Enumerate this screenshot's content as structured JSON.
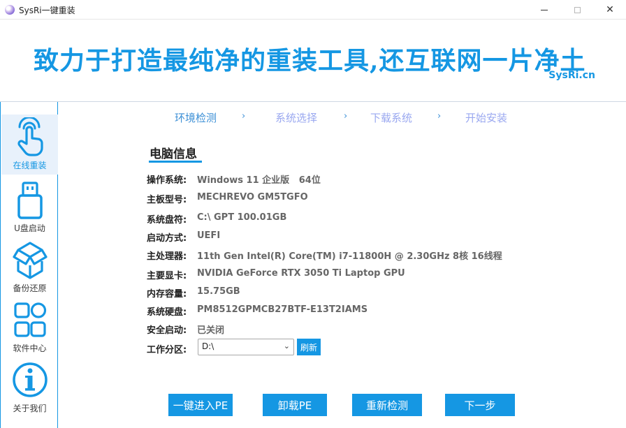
{
  "window": {
    "title": "SysRi一键重装",
    "minimize_icon": "minimize-icon",
    "maximize_icon": "maximize-icon",
    "close_icon": "close-icon",
    "close_glyph": "✕"
  },
  "banner": {
    "slogan": "致力于打造最纯净的重装工具,还互联网一片净土",
    "brand": "SysRi.cn",
    "accent_color": "#1597e3"
  },
  "sidebar": {
    "items": [
      {
        "label": "在线重装",
        "icon": "hand-pointer-icon",
        "active": true
      },
      {
        "label": "U盘启动",
        "icon": "usb-drive-icon",
        "active": false
      },
      {
        "label": "备份还原",
        "icon": "box-backup-icon",
        "active": false
      },
      {
        "label": "软件中心",
        "icon": "apps-grid-icon",
        "active": false
      },
      {
        "label": "关于我们",
        "icon": "info-icon",
        "active": false
      }
    ]
  },
  "steps": {
    "items": [
      "环境检测",
      "系统选择",
      "下载系统",
      "开始安装"
    ],
    "arrow": "›",
    "active_index": 0
  },
  "info": {
    "title": "电脑信息",
    "rows": [
      {
        "label": "操作系统:",
        "value": "Windows 11 企业版   64位"
      },
      {
        "label": "主板型号:",
        "value": "MECHREVO GM5TGFO"
      },
      {
        "label": "系统盘符:",
        "value": "C:\\ GPT 100.01GB"
      },
      {
        "label": "启动方式:",
        "value": "UEFI"
      },
      {
        "label": "主处理器:",
        "value": "11th Gen Intel(R) Core(TM) i7-11800H @ 2.30GHz 8核 16线程"
      },
      {
        "label": "主要显卡:",
        "value": "NVIDIA GeForce RTX 3050 Ti Laptop GPU"
      },
      {
        "label": "内存容量:",
        "value": "15.75GB"
      },
      {
        "label": "系统硬盘:",
        "value": "PM8512GPMCB27BTF-E13T2IAMS"
      },
      {
        "label": "安全启动:",
        "value": "已关闭"
      },
      {
        "label": "工作分区:",
        "value": ""
      }
    ],
    "partition_selected": "D:\\",
    "refresh_label": "刷新"
  },
  "actions": {
    "enter_pe": "一键进入PE",
    "uninstall_pe": "卸载PE",
    "recheck": "重新检测",
    "next": "下一步"
  }
}
